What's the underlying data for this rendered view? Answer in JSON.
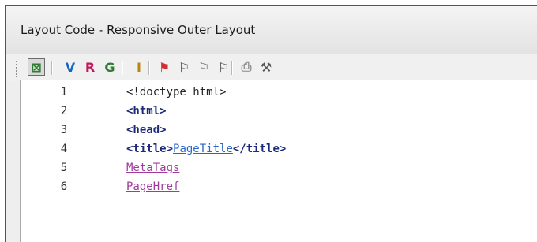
{
  "window": {
    "title": "Layout Code - Responsive Outer Layout"
  },
  "toolbar": {
    "buttons": [
      {
        "name": "layout-toggle-icon",
        "glyph": "⊠",
        "color": "#2e7d32",
        "active": true
      },
      {
        "name": "add-variable-icon",
        "glyph": "V",
        "color": "#1565c0"
      },
      {
        "name": "add-region-icon",
        "glyph": "R",
        "color": "#c2185b"
      },
      {
        "name": "add-group-icon",
        "glyph": "G",
        "color": "#2e7d32"
      },
      {
        "name": "insert-content-icon",
        "glyph": "I",
        "color": "#b8860b"
      },
      {
        "name": "flag-add-icon",
        "glyph": "⚑",
        "color": "#d32f2f"
      },
      {
        "name": "flag-next-icon",
        "glyph": "⚐",
        "color": "#444444"
      },
      {
        "name": "flag-prev-icon",
        "glyph": "⚐",
        "color": "#444444"
      },
      {
        "name": "flag-clear-icon",
        "glyph": "⚐",
        "color": "#444444"
      },
      {
        "name": "print-icon",
        "glyph": "⎙",
        "color": "#8a8a8a"
      },
      {
        "name": "tools-icon",
        "glyph": "⚒",
        "color": "#555555"
      }
    ]
  },
  "editor": {
    "lines": [
      {
        "num": "1",
        "parts": [
          {
            "t": "<!doctype html>",
            "c": "plain"
          }
        ]
      },
      {
        "num": "2",
        "parts": [
          {
            "t": "<html>",
            "c": "tag"
          }
        ]
      },
      {
        "num": "3",
        "parts": [
          {
            "t": "<head>",
            "c": "tag"
          }
        ]
      },
      {
        "num": "4",
        "parts": [
          {
            "t": "<title>",
            "c": "tag"
          },
          {
            "t": "PageTitle",
            "c": "link-blue"
          },
          {
            "t": "</title>",
            "c": "tag"
          }
        ]
      },
      {
        "num": "5",
        "parts": [
          {
            "t": "MetaTags",
            "c": "link-purple"
          }
        ]
      },
      {
        "num": "6",
        "parts": [
          {
            "t": "PageHref",
            "c": "link-purple"
          }
        ]
      }
    ]
  }
}
